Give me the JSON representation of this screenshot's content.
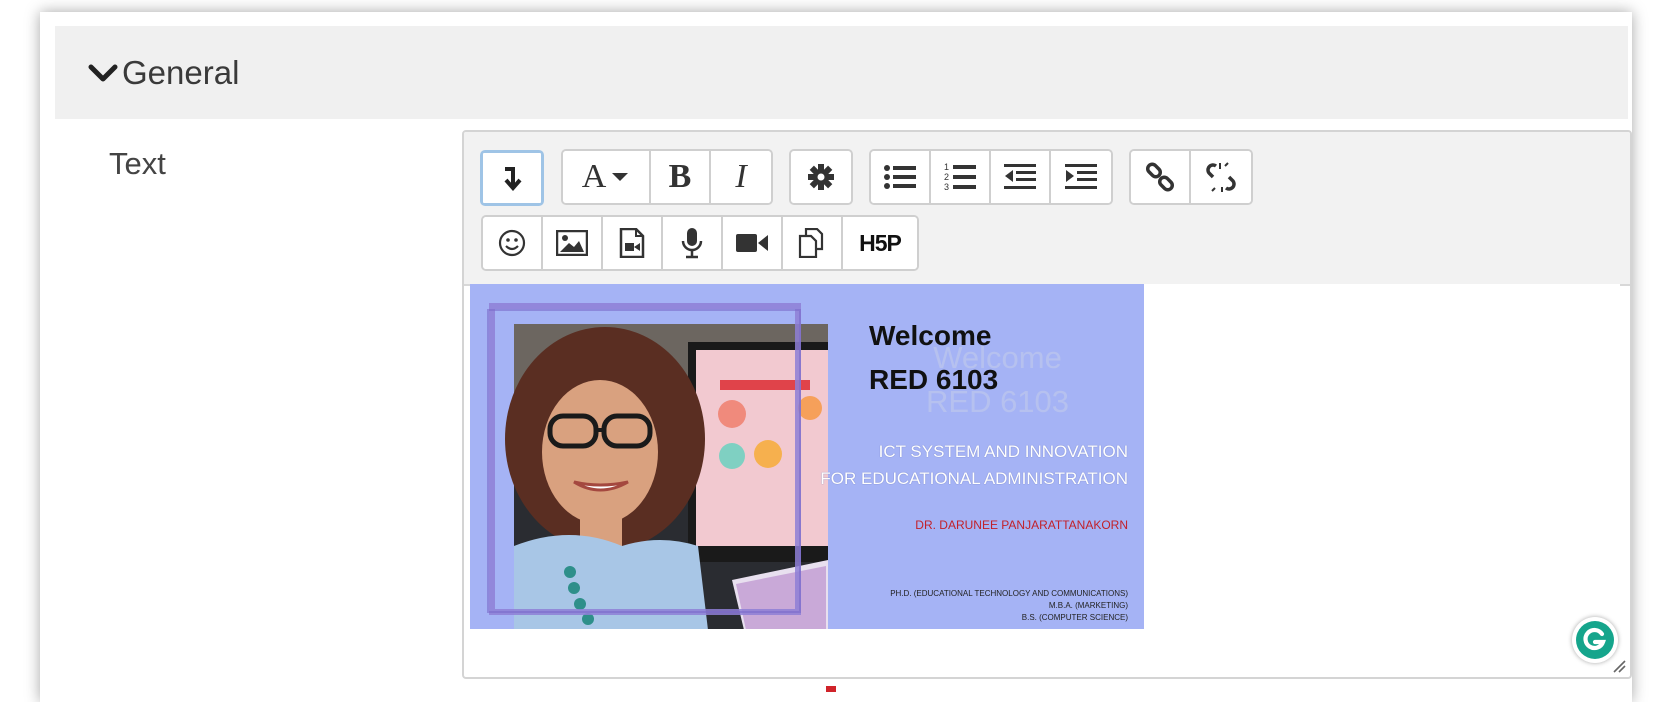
{
  "section": {
    "title": "General"
  },
  "field": {
    "label": "Text"
  },
  "toolbar": {
    "row1": [
      {
        "icon": "show-more-icon"
      },
      {
        "icon": "font-style-icon",
        "label": "A"
      },
      {
        "icon": "bold-icon",
        "label": "B"
      },
      {
        "icon": "italic-icon",
        "label": "I"
      },
      {
        "icon": "settings-icon"
      },
      {
        "icon": "bullet-list-icon"
      },
      {
        "icon": "numbered-list-icon"
      },
      {
        "icon": "outdent-icon"
      },
      {
        "icon": "indent-icon"
      },
      {
        "icon": "link-icon"
      },
      {
        "icon": "unlink-icon"
      }
    ],
    "row2": [
      {
        "icon": "emoji-icon"
      },
      {
        "icon": "image-icon"
      },
      {
        "icon": "media-icon"
      },
      {
        "icon": "microphone-icon"
      },
      {
        "icon": "video-icon"
      },
      {
        "icon": "manage-files-icon"
      },
      {
        "icon": "h5p-icon",
        "label": "H5P"
      }
    ]
  },
  "slide": {
    "heading_line1": "Welcome",
    "heading_line2": "RED 6103",
    "course_line1": "ICT SYSTEM AND INNOVATION",
    "course_line2": "FOR EDUCATIONAL ADMINISTRATION",
    "instructor": "DR. DARUNEE PANJARATTANAKORN",
    "degree1": "PH.D. (EDUCATIONAL TECHNOLOGY AND COMMUNICATIONS)",
    "degree2": "M.B.A. (MARKETING)",
    "degree3": "B.S. (COMPUTER SCIENCE)"
  },
  "colors": {
    "slide_bg": "#a5b3f5",
    "header_bg": "#f0f0f0",
    "grammarly": "#15a58c",
    "instructor": "#c2212a"
  }
}
